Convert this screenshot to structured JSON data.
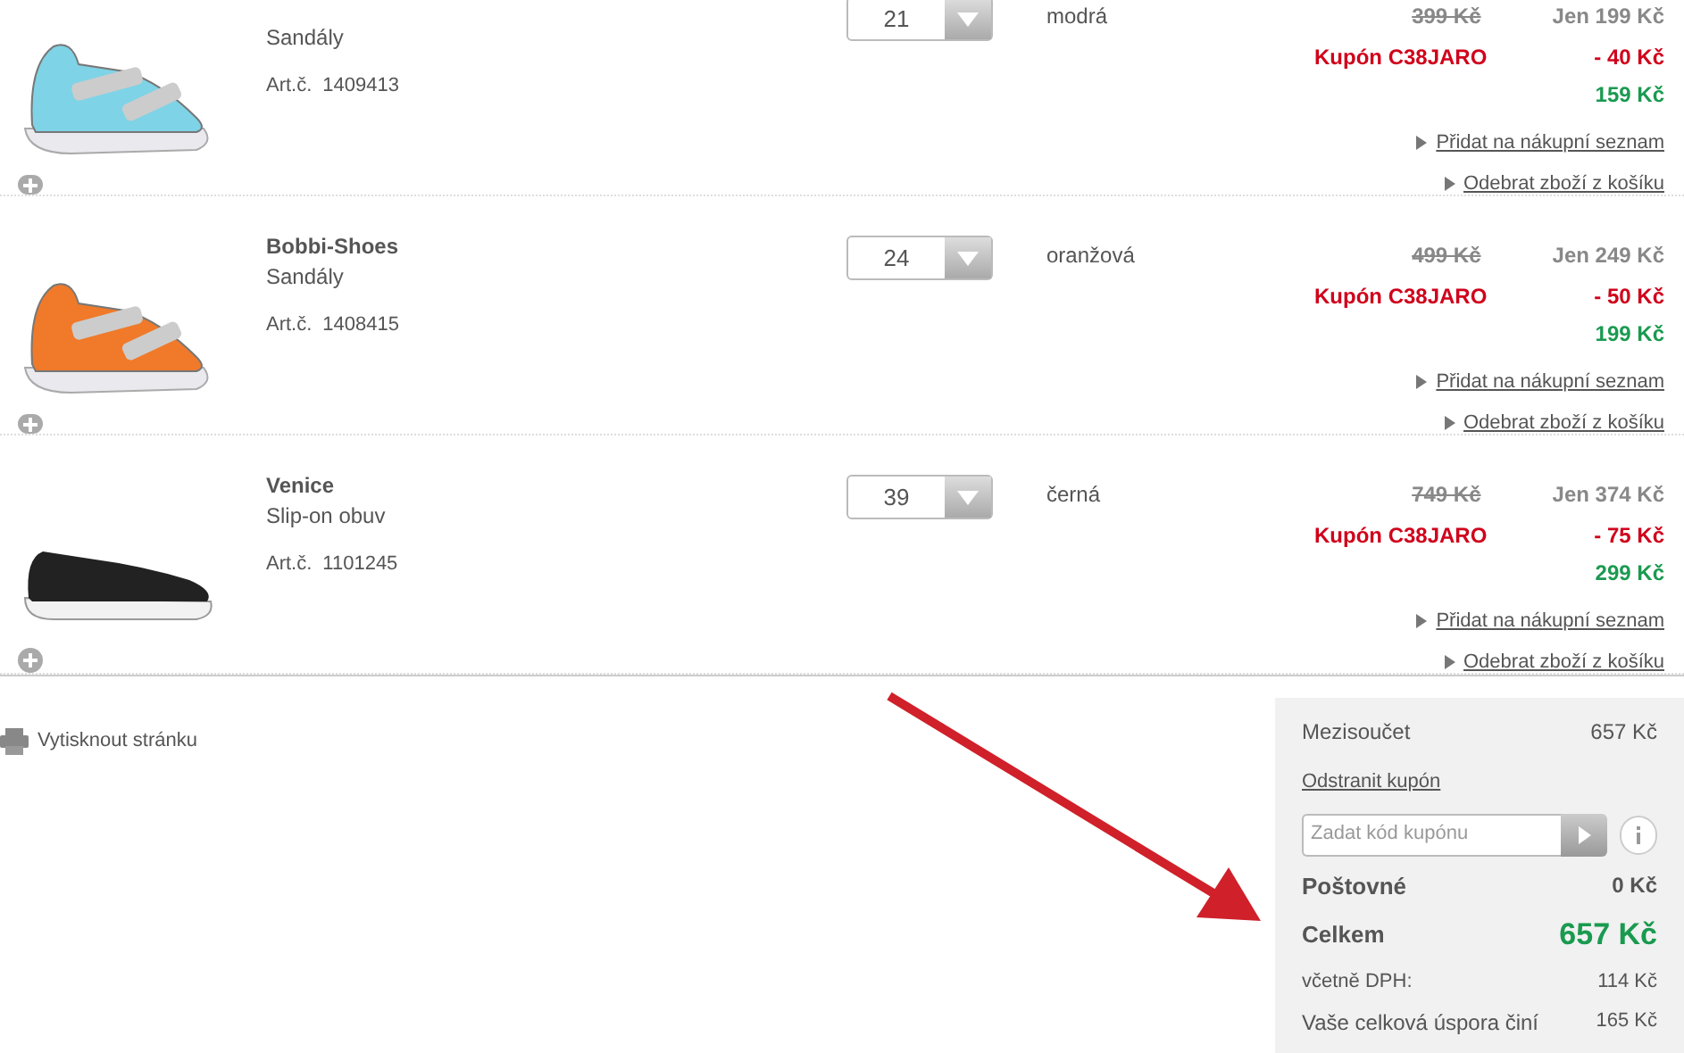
{
  "items": [
    {
      "category": "Sandály",
      "article_label": "Art.č.",
      "article": "1409413",
      "quantity": "21",
      "color_name": "modrá",
      "old_price": "399 Kč",
      "price": "Jen 199 Kč",
      "coupon": "Kupón C38JARO",
      "discount": "- 40 Kč",
      "final_price": "159 Kč",
      "add_link": "Přidat na nákupní seznam",
      "remove_link": "Odebrat zboží z košíku",
      "kind": "sandal"
    },
    {
      "name": "Bobbi-Shoes",
      "category": "Sandály",
      "article_label": "Art.č.",
      "article": "1408415",
      "quantity": "24",
      "color_name": "oranžová",
      "old_price": "499 Kč",
      "price": "Jen 249 Kč",
      "coupon": "Kupón C38JARO",
      "discount": "- 50 Kč",
      "final_price": "199 Kč",
      "add_link": "Přidat na nákupní seznam",
      "remove_link": "Odebrat zboží z košíku",
      "kind": "sandal"
    },
    {
      "name": "Venice",
      "category": "Slip-on obuv",
      "article_label": "Art.č.",
      "article": "1101245",
      "quantity": "39",
      "color_name": "černá",
      "old_price": "749 Kč",
      "price": "Jen 374 Kč",
      "coupon": "Kupón C38JARO",
      "discount": "- 75 Kč",
      "final_price": "299 Kč",
      "add_link": "Přidat na nákupní seznam",
      "remove_link": "Odebrat zboží z košíku",
      "kind": "slipon"
    }
  ],
  "print_link": "Vytisknout stránku",
  "summary": {
    "subtotal_label": "Mezisoučet",
    "subtotal": "657 Kč",
    "remove_coupon": "Odstranit kupón",
    "coupon_placeholder": "Zadat kód kupónu",
    "shipping_label": "Poštovné",
    "shipping": "0 Kč",
    "total_label": "Celkem",
    "total": "657 Kč",
    "vat_label": "včetně DPH:",
    "vat": "114 Kč",
    "savings_label": "Vaše celková úspora činí",
    "savings": "165 Kč"
  }
}
